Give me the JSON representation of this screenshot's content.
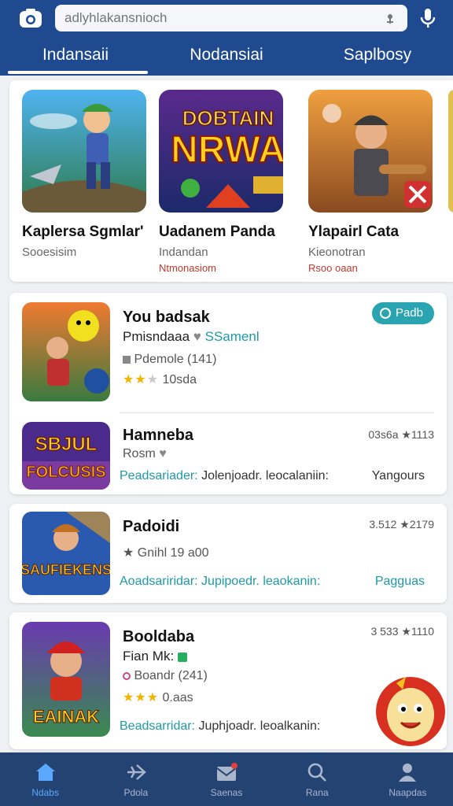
{
  "search": {
    "placeholder": "adlyhlakansnioch"
  },
  "tabs": [
    {
      "label": "Indansaii",
      "active": true
    },
    {
      "label": "Nodansiai",
      "active": false
    },
    {
      "label": "Saplbosy",
      "active": false
    }
  ],
  "featured": [
    {
      "title": "Kaplersa Sgmlar'",
      "subtitle": "Sooesisim",
      "extra": ""
    },
    {
      "title": "Uadanem Panda",
      "subtitle": "Indandan",
      "extra": "Ntmonasiom",
      "art_text": [
        "DOBTAIN",
        "NRWA"
      ]
    },
    {
      "title": "Ylapairl Cata",
      "subtitle": "Kieonotran",
      "extra": "Rsoo oaan"
    }
  ],
  "list": [
    {
      "title": "You badsak",
      "developer": "Pmisndaaa",
      "developer_tag": "SSamenl",
      "meta": "Pdemole (141)",
      "rating_text": "10sda",
      "stars": 2.5,
      "pill": "Padb"
    },
    {
      "title": "Hamneba",
      "developer": "Rosm",
      "right": "03s6a ★1113",
      "link_teal": "Peadsariader:",
      "link_dark": "Jolenjoadr. leocalaniin:",
      "tag": "Yangours",
      "icon_text": [
        "SBJUL",
        "FOLCUSIS"
      ]
    },
    {
      "title": "Padoidi",
      "meta": "★ Gnihl 19 a00",
      "right": "3.512 ★2179",
      "link_teal": "Aoadsariridar: Jupipoedr. leaokanin:",
      "tag": "Pagguas",
      "icon_text": [
        "SAUFIEKENS"
      ]
    },
    {
      "title": "Booldaba",
      "developer": "Fian Mk:",
      "meta": "Boandr (241)",
      "rating_text": "0.aas",
      "stars": 3,
      "right": "3 533 ★1110",
      "link_teal": "Beadsarridar:",
      "link_dark": "Juphjoadr. leoalkanin:",
      "icon_text": [
        "EAINAK"
      ]
    }
  ],
  "bottom_nav": [
    {
      "label": "Ndabs",
      "icon": "home-icon",
      "active": true
    },
    {
      "label": "Pdola",
      "icon": "plane-icon",
      "active": false
    },
    {
      "label": "Saenas",
      "icon": "mail-icon",
      "active": false
    },
    {
      "label": "Rana",
      "icon": "search-icon",
      "active": false
    },
    {
      "label": "Naapdas",
      "icon": "profile-icon",
      "active": false
    }
  ],
  "colors": {
    "header": "#1f4a8f",
    "accent": "#1d9aa6",
    "nav": "#234373",
    "nav_active": "#5aa8ff"
  }
}
